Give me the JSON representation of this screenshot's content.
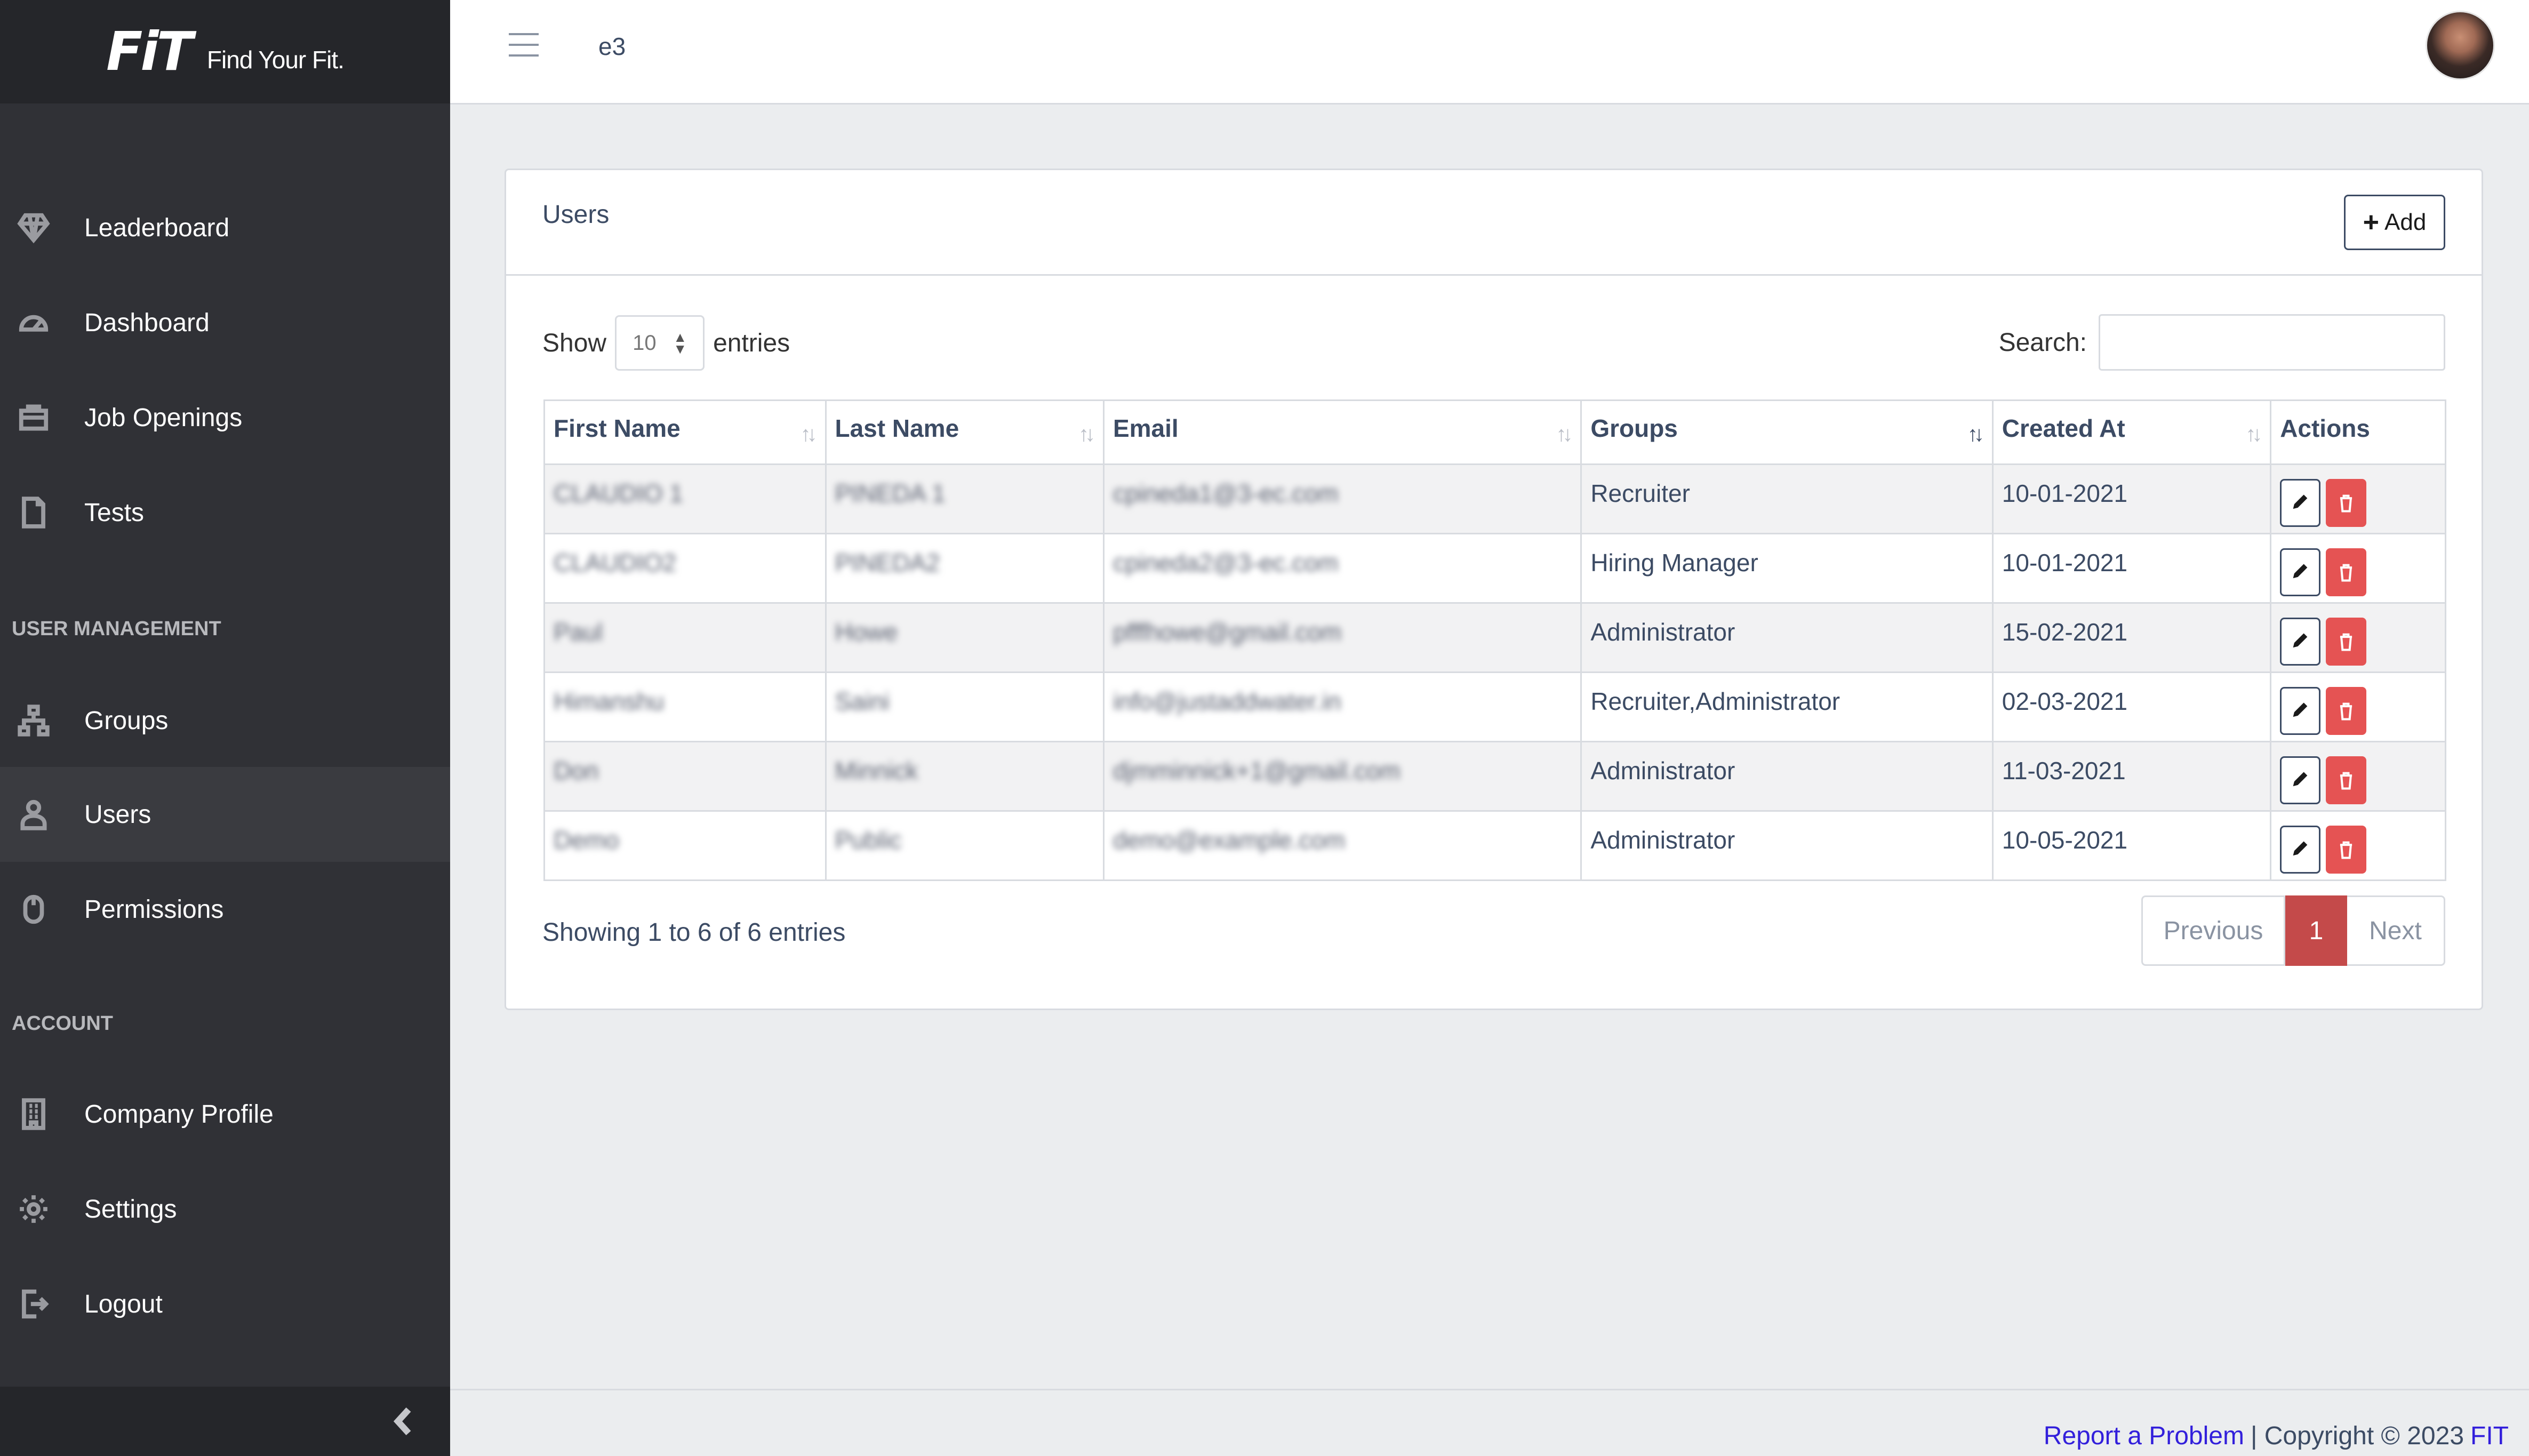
{
  "brand": {
    "logo": "FiT",
    "tagline": "Find Your Fit."
  },
  "header": {
    "org": "e3"
  },
  "sidebar": {
    "items": [
      {
        "label": "Leaderboard",
        "icon": "diamond-icon"
      },
      {
        "label": "Dashboard",
        "icon": "speedometer-icon"
      },
      {
        "label": "Job Openings",
        "icon": "briefcase-icon"
      },
      {
        "label": "Tests",
        "icon": "file-icon"
      }
    ],
    "section_user_mgmt": "USER MANAGEMENT",
    "user_mgmt_items": [
      {
        "label": "Groups",
        "icon": "sitemap-icon"
      },
      {
        "label": "Users",
        "icon": "user-icon",
        "active": true
      },
      {
        "label": "Permissions",
        "icon": "mouse-icon"
      }
    ],
    "section_account": "ACCOUNT",
    "account_items": [
      {
        "label": "Company Profile",
        "icon": "building-icon"
      },
      {
        "label": "Settings",
        "icon": "gear-icon"
      },
      {
        "label": "Logout",
        "icon": "logout-icon"
      }
    ]
  },
  "card": {
    "title": "Users",
    "add_label": "Add",
    "show_label": "Show",
    "entries_value": "10",
    "entries_label": "entries",
    "search_label": "Search:"
  },
  "table": {
    "headers": [
      "First Name",
      "Last Name",
      "Email",
      "Groups",
      "Created At",
      "Actions"
    ],
    "rows": [
      {
        "first": "CLAUDIO 1",
        "last": "PINEDA 1",
        "email": "cpineda1@3-ec.com",
        "groups": "Recruiter",
        "created": "10-01-2021"
      },
      {
        "first": "CLAUDIO2",
        "last": "PINEDA2",
        "email": "cpineda2@3-ec.com",
        "groups": "Hiring Manager",
        "created": "10-01-2021"
      },
      {
        "first": "Paul",
        "last": "Howe",
        "email": "pfffhowe@gmail.com",
        "groups": "Administrator",
        "created": "15-02-2021"
      },
      {
        "first": "Himanshu",
        "last": "Saini",
        "email": "info@justaddwater.in",
        "groups": "Recruiter,Administrator",
        "created": "02-03-2021"
      },
      {
        "first": "Don",
        "last": "Minnick",
        "email": "djmminnick+1@gmail.com",
        "groups": "Administrator",
        "created": "11-03-2021"
      },
      {
        "first": "Demo",
        "last": "Public",
        "email": "demo@example.com",
        "groups": "Administrator",
        "created": "10-05-2021"
      }
    ]
  },
  "pagination": {
    "info": "Showing 1 to 6 of 6 entries",
    "previous": "Previous",
    "current": "1",
    "next": "Next"
  },
  "footer": {
    "report": "Report a Problem",
    "copyright": "| Copyright © 2023",
    "brand": "FIT"
  },
  "colors": {
    "sidebar": "#303136",
    "accent_red": "#e55353",
    "link": "#321fdb"
  }
}
